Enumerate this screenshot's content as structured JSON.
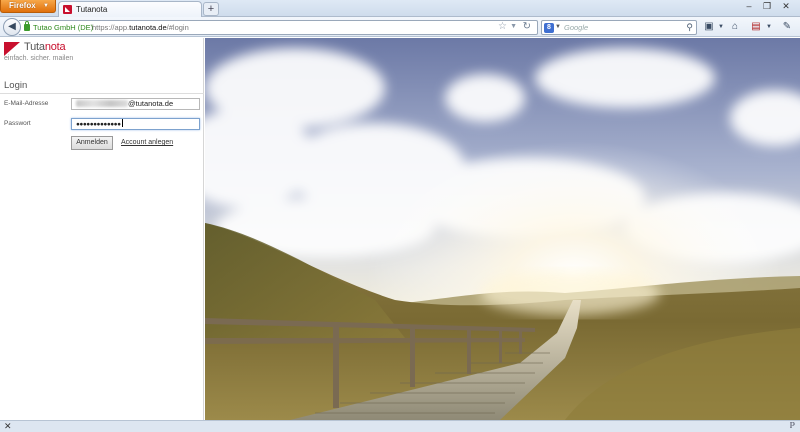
{
  "browser": {
    "menu_label": "Firefox",
    "tab_title": "Tutanota",
    "identity": "Tutao GmbH (DE)",
    "url_prefix": "https://app.",
    "url_host": "tutanota.de",
    "url_path": "/#login",
    "search_placeholder": "Google"
  },
  "app": {
    "brand_a": "Tuta",
    "brand_b": "nota",
    "slogan": "einfach. sicher. mailen",
    "brand_color": "#c8102e"
  },
  "login": {
    "title": "Login",
    "email_label": "E-Mail-Adresse",
    "email_domain": "@tutanota.de",
    "password_label": "Passwort",
    "password_value": "●●●●●●●●●●●●●",
    "submit_label": "Anmelden",
    "create_account_label": "Account anlegen"
  },
  "icons": {
    "back": "arrow-left-icon",
    "bookmark": "star-icon",
    "reload": "reload-icon",
    "search": "magnifier-icon",
    "home": "home-icon",
    "close": "close-icon"
  }
}
